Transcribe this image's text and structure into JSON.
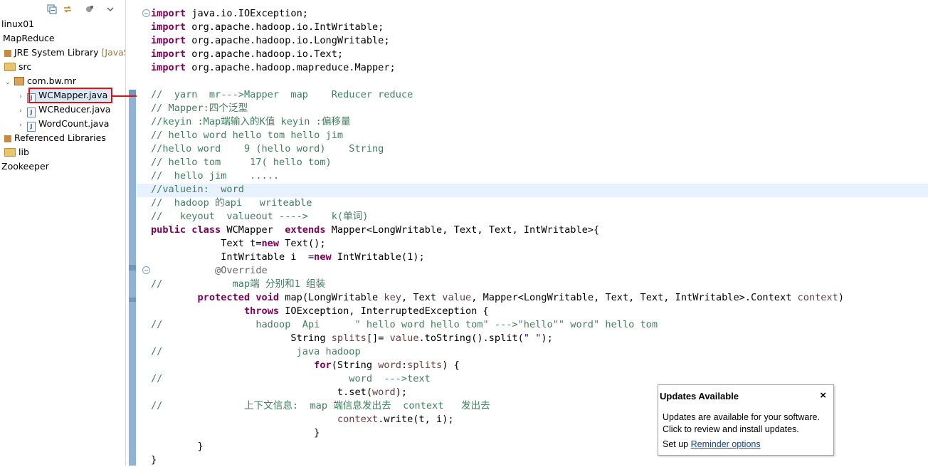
{
  "explorer": {
    "items": [
      {
        "label": "linux01",
        "twisty": ""
      },
      {
        "label": "MapReduce",
        "twisty": ""
      },
      {
        "label": "JRE System Library",
        "decoration": "[JavaS",
        "twisty": ""
      },
      {
        "label": "src",
        "twisty": ""
      },
      {
        "label": "com.bw.mr",
        "twisty": "⌄"
      },
      {
        "label": "WCMapper.java",
        "twisty": "›"
      },
      {
        "label": "WCReducer.java",
        "twisty": "›"
      },
      {
        "label": "WordCount.java",
        "twisty": "›"
      },
      {
        "label": "Referenced Libraries",
        "twisty": ""
      },
      {
        "label": "lib",
        "twisty": ""
      },
      {
        "label": "Zookeeper",
        "twisty": ""
      }
    ]
  },
  "editor": {
    "lines": [
      "import java.io.IOException;",
      "import org.apache.hadoop.io.IntWritable;",
      "import org.apache.hadoop.io.LongWritable;",
      "import org.apache.hadoop.io.Text;",
      "import org.apache.hadoop.mapreduce.Mapper;",
      "",
      "//  yarn  mr--->Mapper  map    Reducer reduce",
      "// Mapper:四个泛型",
      "//keyin :Map端输入的K值 keyin :偏移量",
      "// hello word hello tom hello jim",
      "//hello word    9 (hello word)    String",
      "// hello tom     17( hello tom)",
      "//  hello jim    .....",
      "//valuein:  word",
      "//  hadoop 的api   writeable",
      "//   keyout  valueout ---->    k(单词)",
      "public class WCMapper  extends Mapper<LongWritable, Text, Text, IntWritable>{",
      "            Text t=new Text();",
      "            IntWritable i  =new IntWritable(1);",
      "           @Override",
      "//            map端 分别和1 组装",
      "        protected void map(LongWritable key, Text value, Mapper<LongWritable, Text, Text, IntWritable>.Context context)",
      "                throws IOException, InterruptedException {",
      "//                hadoop  Api      \" hello word hello tom\" --->\"hello\"\" word\" hello tom",
      "                        String splits[]= value.toString().split(\" \");",
      "//                       java hadoop",
      "                            for(String word:splits) {",
      "//                                word  --->text",
      "                                t.set(word);",
      "//              上下文信息:  map 端信息发出去  context   发出去",
      "                                context.write(t, i);",
      "                            }",
      "        }",
      "}"
    ]
  },
  "notification": {
    "title": "Updates Available",
    "close": "×",
    "body": "Updates are available for your software. Click to review and install updates.",
    "footer_prefix": "Set up ",
    "footer_link": "Reminder options"
  },
  "colors": {
    "keyword": "#7f0055",
    "comment": "#3f7f5f",
    "annotation": "#646464",
    "string": "#2a00ff",
    "highlight": "#e01010",
    "current_line": "#e8f2fe"
  }
}
